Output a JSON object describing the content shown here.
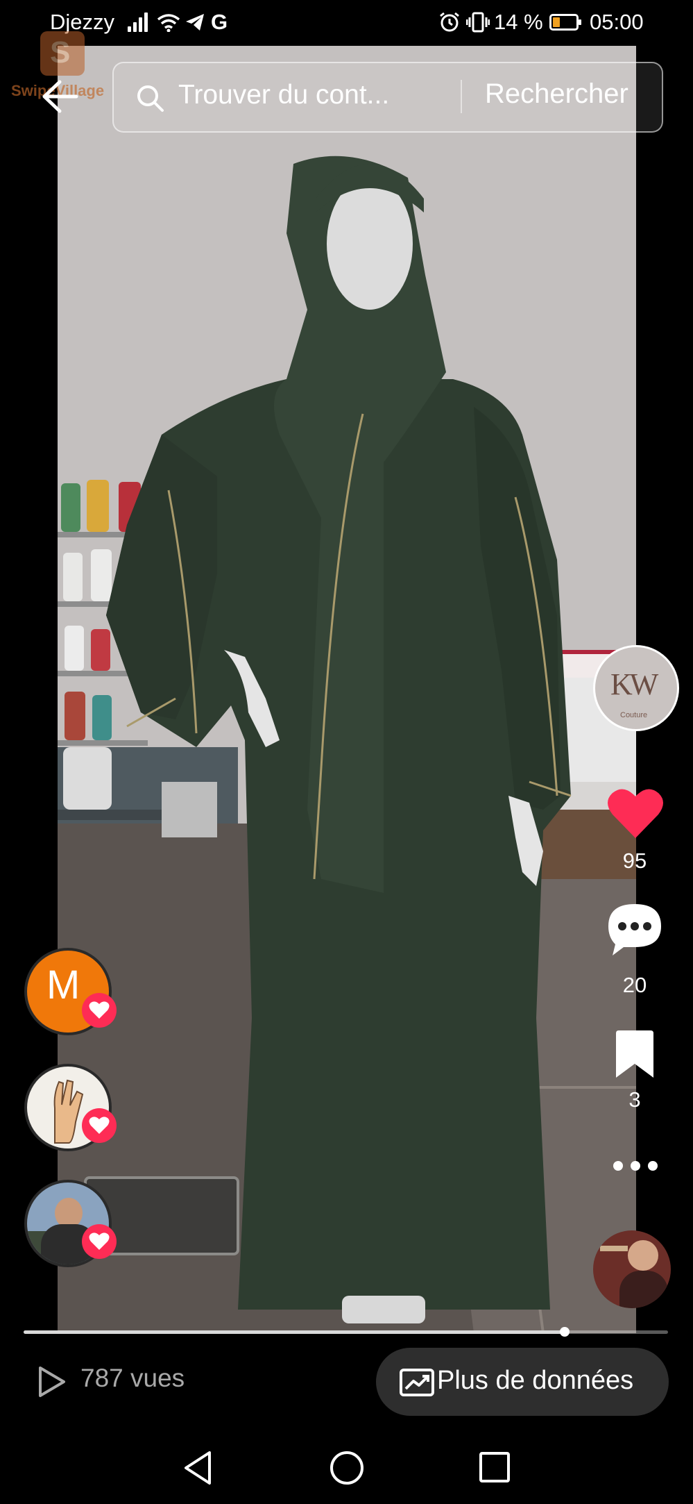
{
  "status_bar": {
    "carrier": "Djezzy",
    "network_letter": "G",
    "battery": "14 %",
    "time": "05:00"
  },
  "watermark": {
    "text": "SwipeVillage"
  },
  "search": {
    "placeholder": "Trouver du cont...",
    "button_label": "Rechercher"
  },
  "creator": {
    "avatar_initials": "KW",
    "avatar_caption": "Couture"
  },
  "actions": {
    "likes": "95",
    "comments": "20",
    "saves": "3"
  },
  "likers": [
    {
      "initial": "M",
      "color": "#f0780a"
    },
    {
      "initial": "",
      "color": "#f2efe9"
    },
    {
      "initial": "",
      "color": "#5d7a9a"
    }
  ],
  "playback": {
    "progress": 0.84
  },
  "footer": {
    "views": "787 vues",
    "data_button_label": "Plus de données"
  },
  "colors": {
    "like_red": "#fe2c55",
    "dress_green": "#2f3f31"
  }
}
